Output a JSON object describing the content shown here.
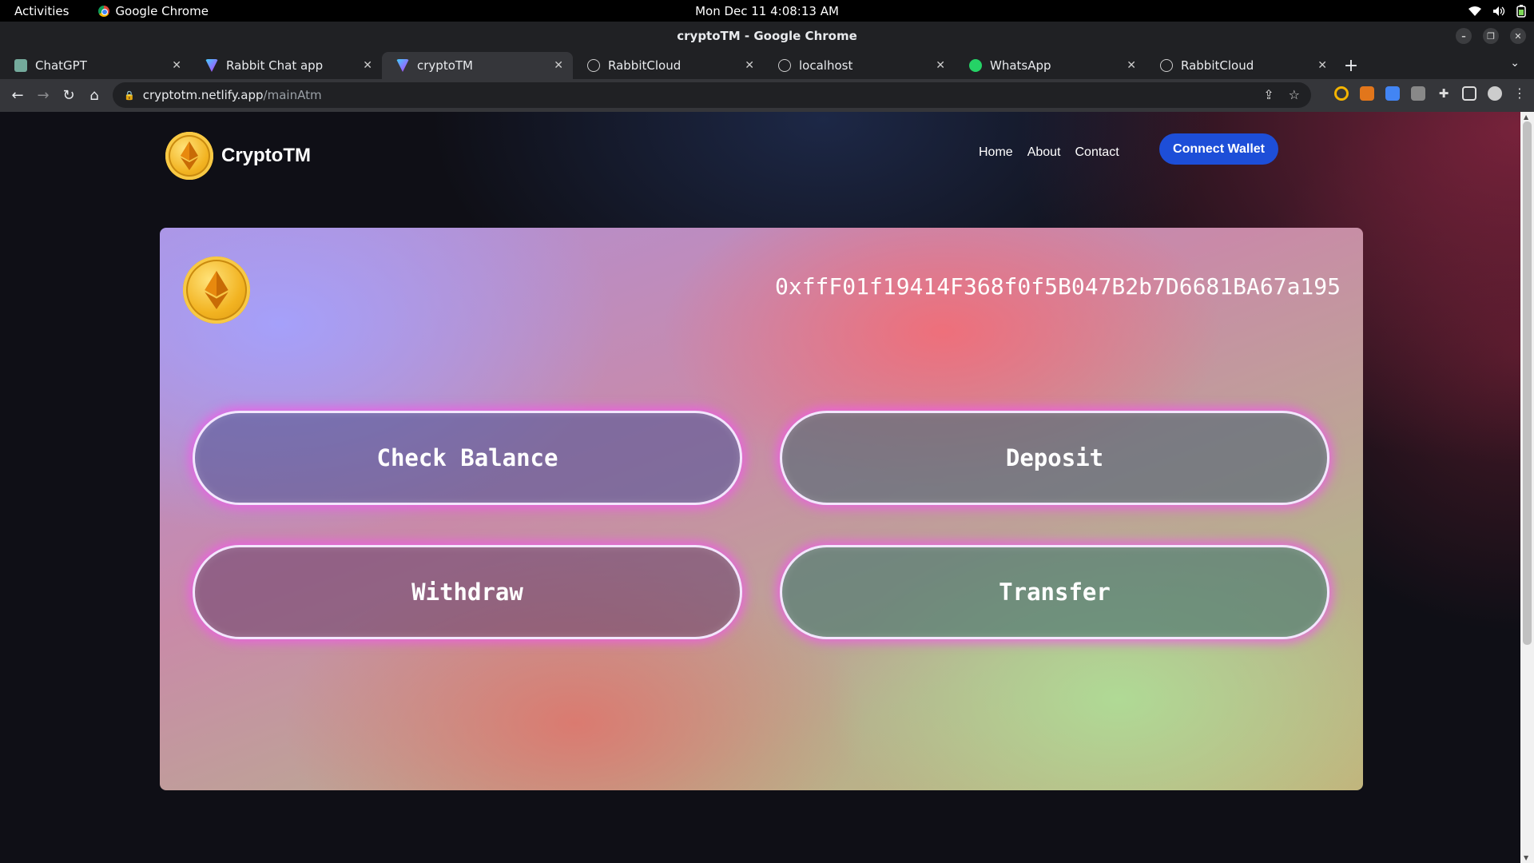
{
  "os": {
    "activities": "Activities",
    "app_name": "Google Chrome",
    "clock": "Mon Dec 11   4:08:13 AM"
  },
  "window": {
    "title": "cryptoTM - Google Chrome"
  },
  "tabs": [
    {
      "label": "ChatGPT",
      "icon": "chatgpt-icon"
    },
    {
      "label": "Rabbit Chat app",
      "icon": "vite-icon"
    },
    {
      "label": "cryptoTM",
      "icon": "vite-icon",
      "active": true
    },
    {
      "label": "RabbitCloud",
      "icon": "globe-icon"
    },
    {
      "label": "localhost",
      "icon": "globe-icon"
    },
    {
      "label": "WhatsApp",
      "icon": "whatsapp-icon"
    },
    {
      "label": "RabbitCloud",
      "icon": "globe-icon"
    }
  ],
  "address_bar": {
    "host": "cryptotm.netlify.app",
    "path": "/mainAtm"
  },
  "site": {
    "brand": "CryptoTM",
    "nav": {
      "home": "Home",
      "about": "About",
      "contact": "Contact"
    },
    "connect_wallet": "Connect Wallet"
  },
  "atm": {
    "wallet_address": "0xffF01f19414F368f0f5B047B2b7D6681BA67a195",
    "actions": {
      "check_balance": "Check Balance",
      "deposit": "Deposit",
      "withdraw": "Withdraw",
      "transfer": "Transfer"
    }
  },
  "colors": {
    "connect_button": "#1d4ed8",
    "coin_gold": "#f2b321",
    "button_glow": "#f05ae6"
  }
}
